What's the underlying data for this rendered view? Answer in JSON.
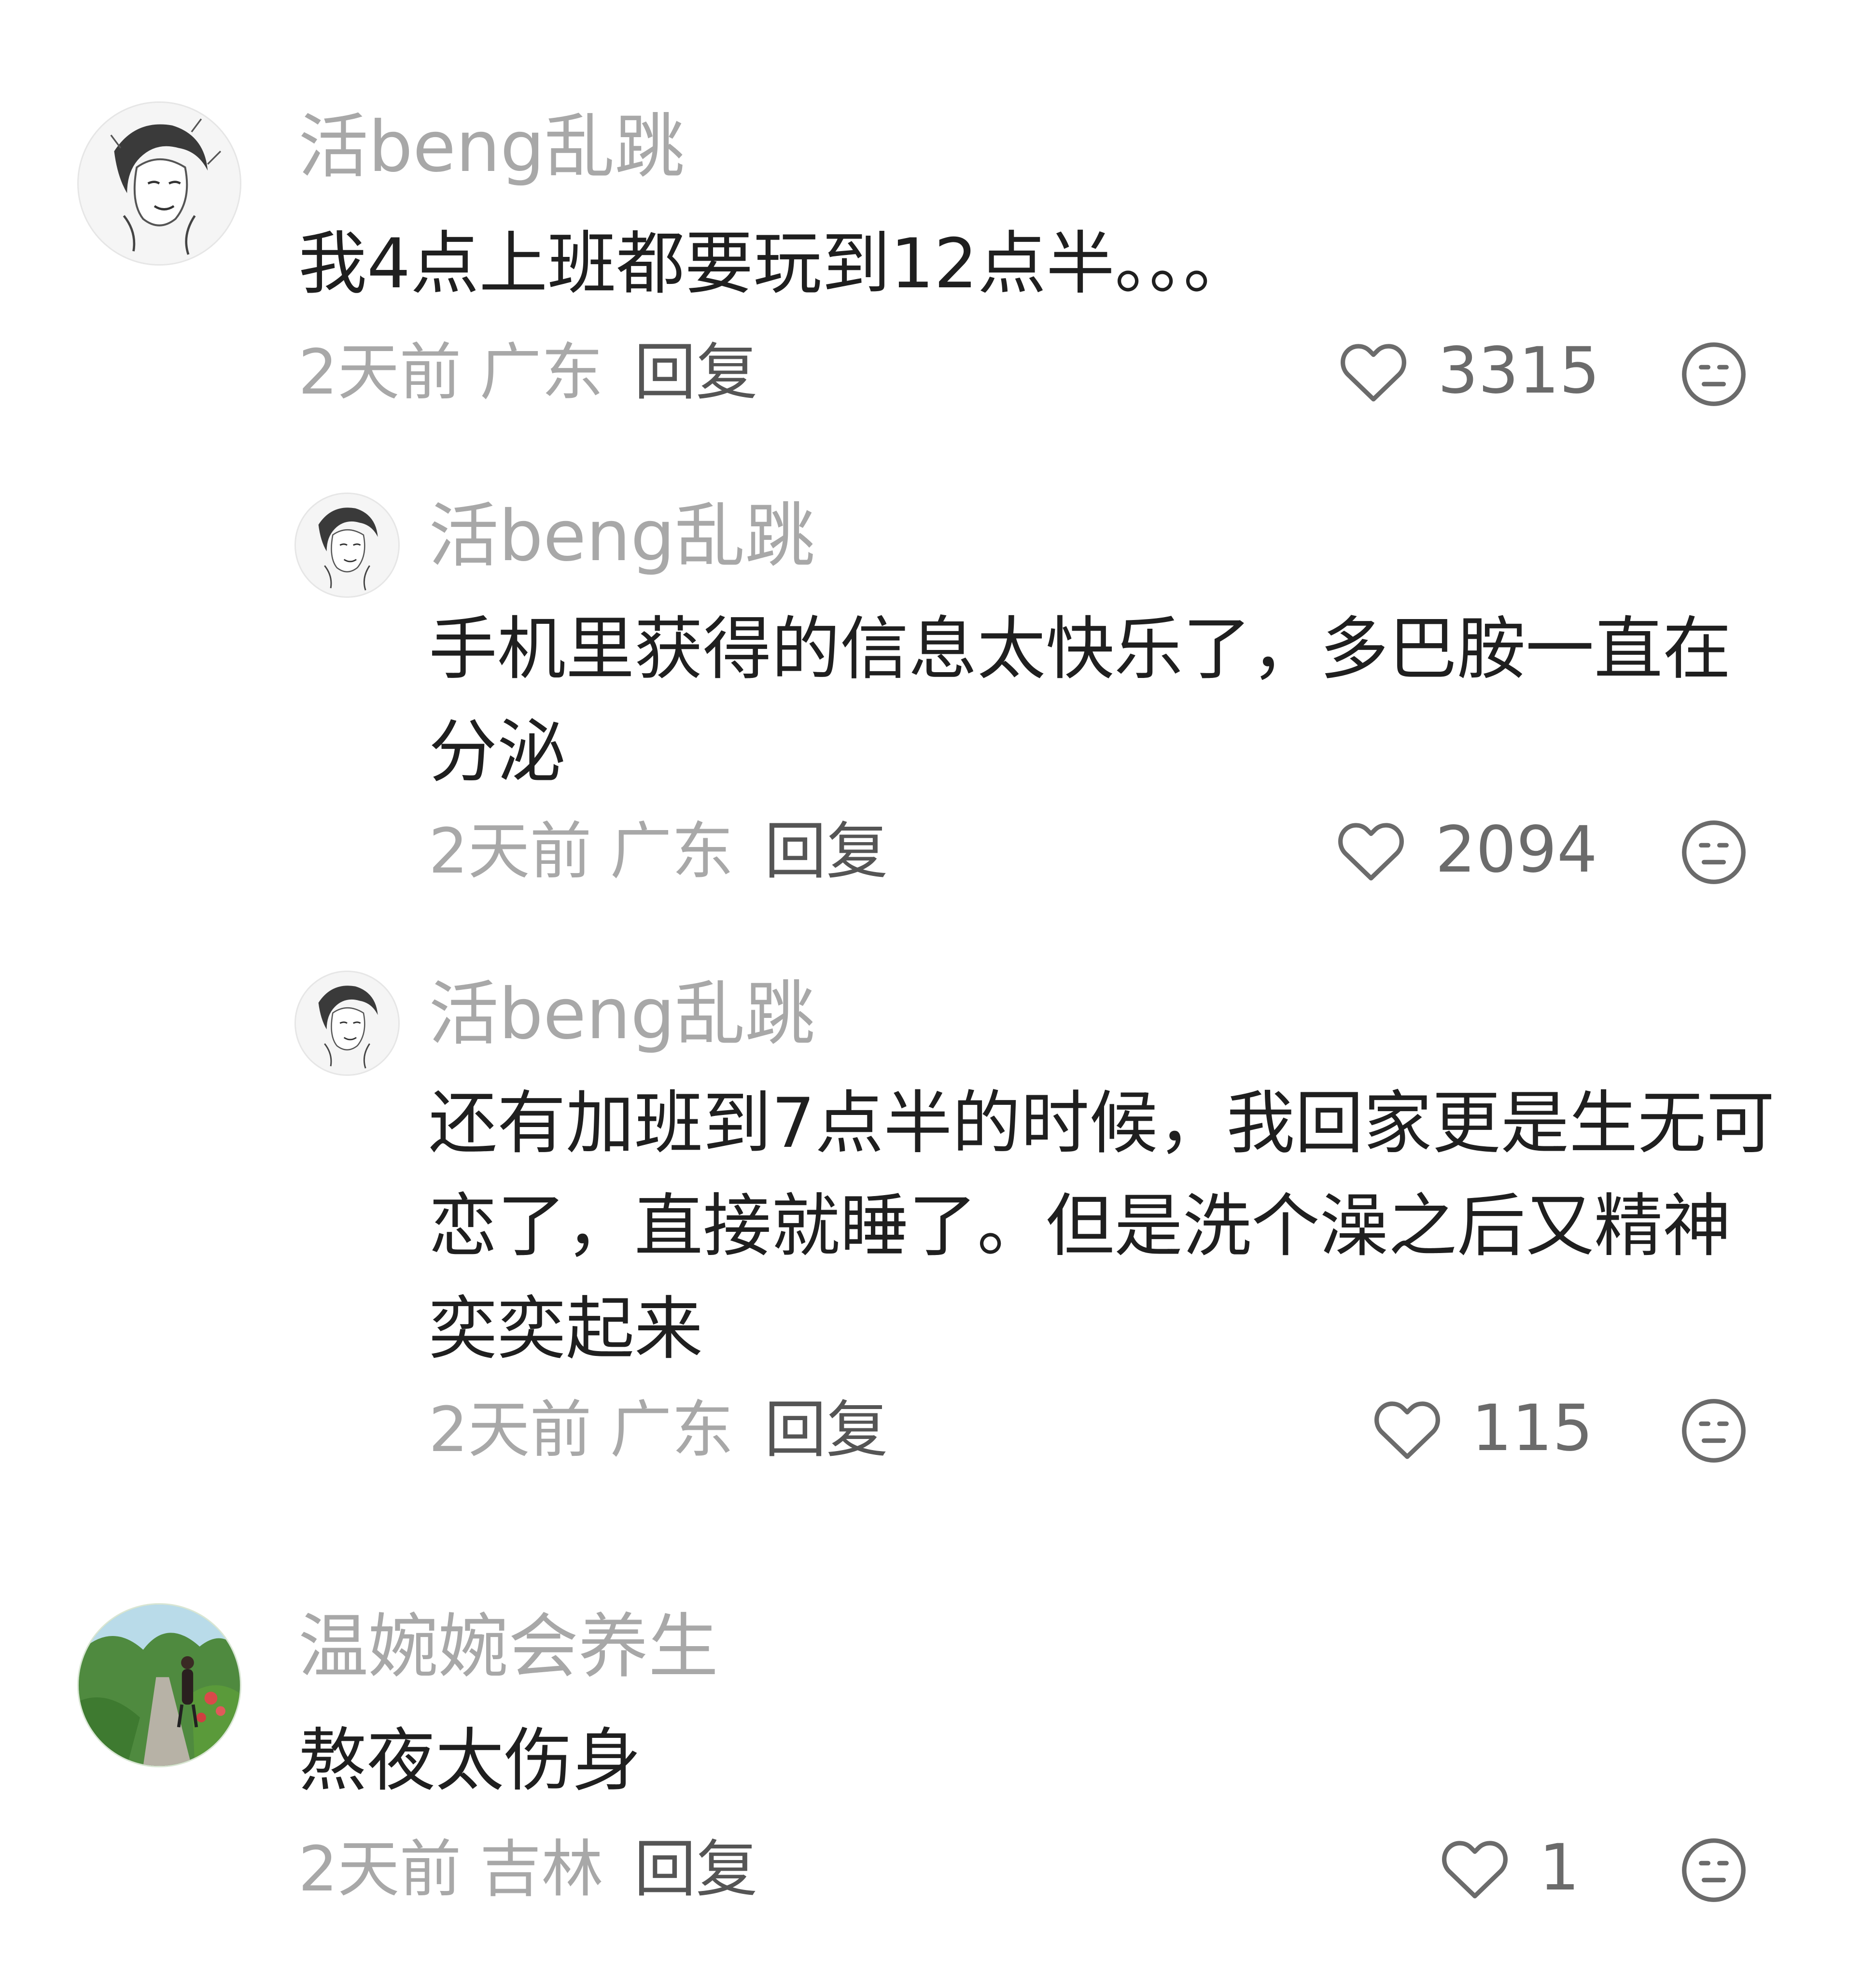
{
  "comments": [
    {
      "username": "活beng乱跳",
      "text": "我4点上班都要玩到12点半。。。",
      "time": "2天前",
      "location": "广东",
      "reply_label": "回复",
      "likes": "3315"
    },
    {
      "username": "活beng乱跳",
      "text": "手机里获得的信息太快乐了，多巴胺一直在分泌",
      "time": "2天前",
      "location": "广东",
      "reply_label": "回复",
      "likes": "2094"
    },
    {
      "username": "活beng乱跳",
      "text": "还有加班到7点半的时候，我回家更是生无可恋了，直接就睡了。但是洗个澡之后又精神奕奕起来",
      "time": "2天前",
      "location": "广东",
      "reply_label": "回复",
      "likes": "115"
    },
    {
      "username": "温婉婉会养生",
      "text": "熬夜太伤身",
      "time": "2天前",
      "location": "吉林",
      "reply_label": "回复",
      "likes": "1"
    }
  ],
  "icons": {
    "like": "heart-outline-icon",
    "dislike": "neutral-face-icon"
  },
  "colors": {
    "username": "#a8a8a8",
    "body_text": "#1f1f1f",
    "meta": "#a8a8a8",
    "reply": "#555555",
    "icon": "#6b6b6b"
  }
}
